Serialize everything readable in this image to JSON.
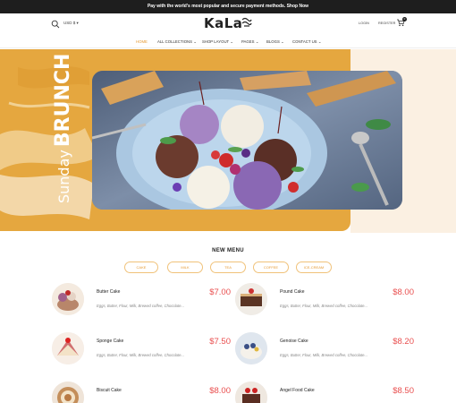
{
  "announcement": "Pay with the world's most popular and secure payment methods. Shop Now",
  "header": {
    "currency": "USD $",
    "logo": "KaLa",
    "login": "LOGIN",
    "register": "REGISTER",
    "cart_count": "0"
  },
  "nav": {
    "items": [
      "HOME",
      "ALL COLLECTIONS",
      "SHOP LAYOUT",
      "PAGES",
      "BLOGS",
      "CONTACT US"
    ]
  },
  "hero": {
    "line1": "Sunday",
    "line2": "BRUNCH"
  },
  "menu": {
    "title": "NEW MENU",
    "filters": [
      "CAKE",
      "MILK",
      "TEA",
      "COFFEE",
      "ICE-CREAM"
    ],
    "items": [
      {
        "name": "Butter Cake",
        "desc": "Eggs, Butter, Flour, Milk, Brewed coffee, Chocolate...",
        "price": "$7.00"
      },
      {
        "name": "Pound Cake",
        "desc": "Eggs, Butter, Flour, Milk, Brewed coffee, Chocolate...",
        "price": "$8.00"
      },
      {
        "name": "Sponge Cake",
        "desc": "Eggs, Butter, Flour, Milk, Brewed coffee, Chocolate...",
        "price": "$7.50"
      },
      {
        "name": "Genoise Cake",
        "desc": "Eggs, Butter, Flour, Milk, Brewed coffee, Chocolate...",
        "price": "$8.20"
      },
      {
        "name": "Biscuit Cake",
        "desc": "",
        "price": "$8.00"
      },
      {
        "name": "Angel Food Cake",
        "desc": "",
        "price": "$8.50"
      }
    ]
  },
  "colors": {
    "accent": "#e59a34",
    "hero_yellow": "#e5a73f",
    "price": "#e94f4f",
    "topbar": "#1e1e1e"
  }
}
